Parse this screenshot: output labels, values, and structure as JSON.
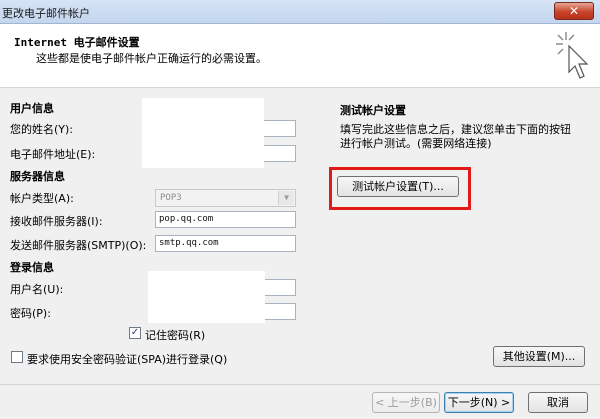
{
  "window": {
    "title": "更改电子邮件帐户",
    "close_label": "✕"
  },
  "header": {
    "title": "Internet 电子邮件设置",
    "subtitle": "这些都是使电子邮件帐户正确运行的必需设置。"
  },
  "user_info": {
    "section": "用户信息",
    "name_label": "您的姓名(Y):",
    "email_label": "电子邮件地址(E):"
  },
  "server_info": {
    "section": "服务器信息",
    "account_type_label": "帐户类型(A):",
    "account_type_value": "POP3",
    "incoming_label": "接收邮件服务器(I):",
    "incoming_value": "pop.qq.com",
    "outgoing_label": "发送邮件服务器(SMTP)(O):",
    "outgoing_value": "smtp.qq.com"
  },
  "login_info": {
    "section": "登录信息",
    "username_label": "用户名(U):",
    "password_label": "密码(P):",
    "remember_label": "记住密码(R)",
    "remember_checked": "✓",
    "spa_label": "要求使用安全密码验证(SPA)进行登录(Q)"
  },
  "test": {
    "section": "测试帐户设置",
    "description": "填写完此这些信息之后，建议您单击下面的按钮进行帐户测试。(需要网络连接)",
    "button": "测试帐户设置(T)..."
  },
  "buttons": {
    "more_settings": "其他设置(M)...",
    "back": "< 上一步(B)",
    "next": "下一步(N) >",
    "cancel": "取消"
  }
}
